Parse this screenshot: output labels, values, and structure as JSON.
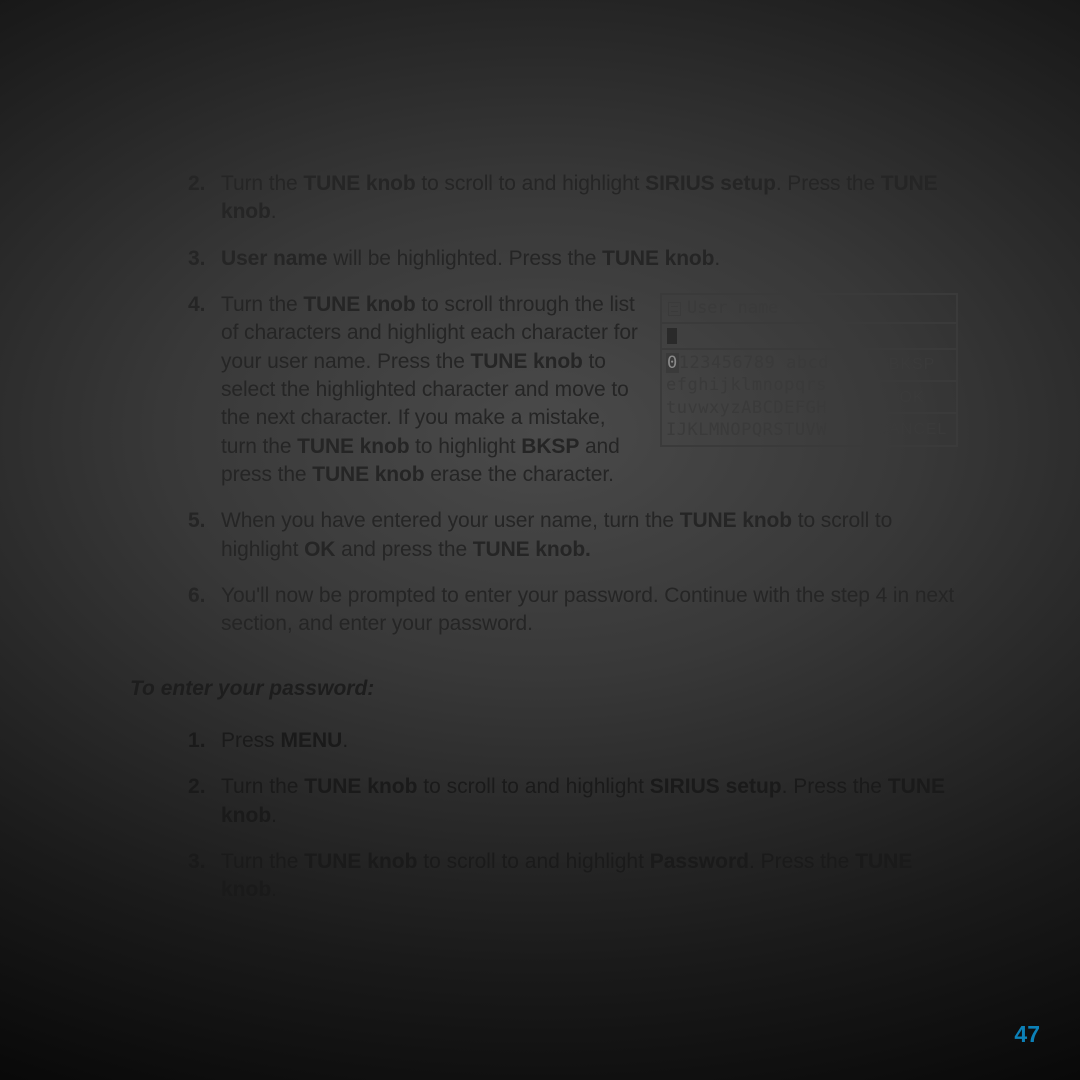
{
  "steps_username": {
    "s2": {
      "pre": "Turn the ",
      "b1": "TUNE knob",
      "mid": " to scroll to and highlight ",
      "b2": "SIRIUS setup",
      "post1": ". Press the ",
      "b3": "TUNE knob",
      "post2": "."
    },
    "s3": {
      "b1": "User name",
      "mid": " will be highlighted. Press the ",
      "b2": "TUNE knob",
      "post": "."
    },
    "s4": {
      "t1": "Turn the ",
      "b1": "TUNE knob",
      "t2": " to scroll through the list of characters and highlight each character for your user name. Press the ",
      "b2": "TUNE knob",
      "t3": " to select the highlighted character and move to the next character. If you make a mistake, turn the ",
      "b3": "TUNE knob",
      "t4": " to highlight ",
      "b4": "BKSP",
      "t5": " and press the ",
      "b5": "TUNE knob",
      "t6": " erase the character."
    },
    "s5": {
      "t1": "When you have entered your user name, turn the ",
      "b1": "TUNE knob",
      "t2": " to scroll to highlight ",
      "b2": "OK",
      "t3": " and press the ",
      "b3": "TUNE knob.",
      "t4": ""
    },
    "s6": "You'll now be prompted to enter your password. Continue with the step 4 in next section, and enter your password."
  },
  "section_sub": "To enter your password:",
  "steps_password": {
    "s1": {
      "t1": "Press ",
      "b1": "MENU",
      "t2": "."
    },
    "s2": {
      "t1": "Turn the ",
      "b1": "TUNE knob",
      "t2": " to scroll to and highlight ",
      "b2": "SIRIUS setup",
      "t3": ". Press the ",
      "b3": "TUNE knob",
      "t4": "."
    },
    "s3": {
      "t1": "Turn the ",
      "b1": "TUNE knob",
      "t2": " to scroll to and highlight ",
      "b2": "Password",
      "t3": ". Press the ",
      "b3": "TUNE knob",
      "t4": "."
    }
  },
  "screen": {
    "title": "User name",
    "rows": {
      "r1_hl": "0",
      "r1_rest": "123456789 abcd",
      "r2": "efghijklmnopqrs",
      "r3": "tuvwxyzABCDEFGH",
      "r4": "IJKLMNOPQRSTUVW"
    },
    "buttons": {
      "bksp": "BKSP",
      "ok": "OK",
      "cancel": "CANCEL"
    }
  },
  "page_number": "47"
}
